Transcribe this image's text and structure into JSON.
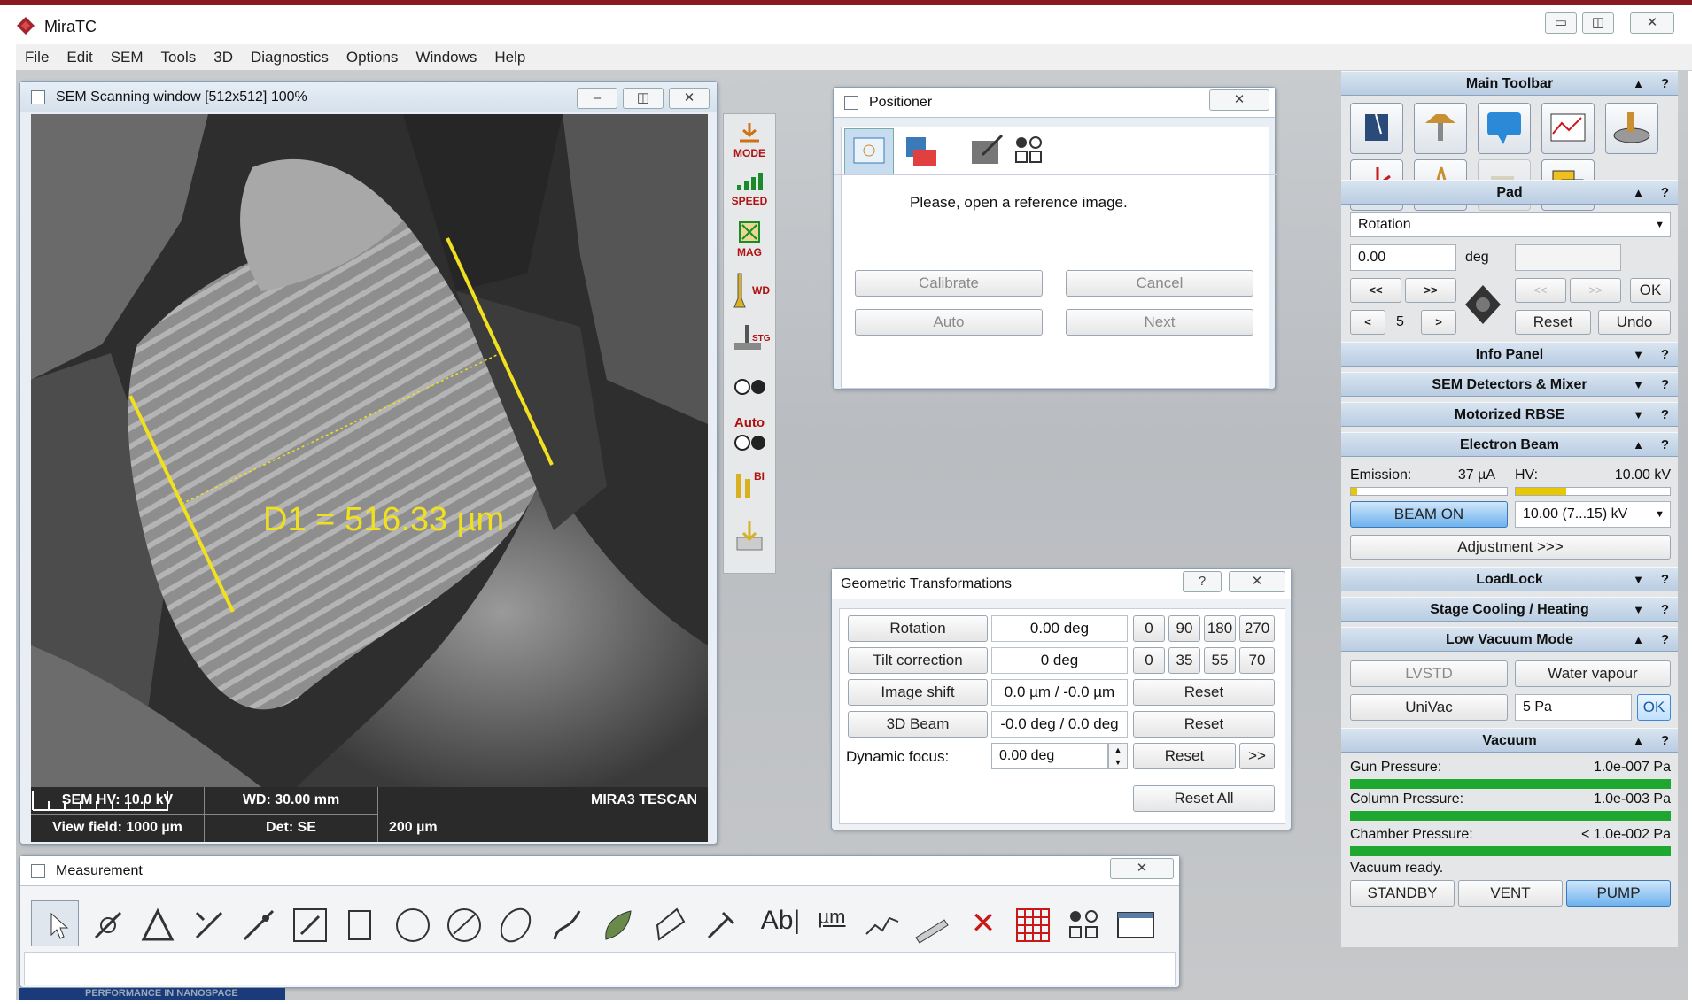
{
  "app": {
    "title": "MiraTC"
  },
  "menu": [
    "File",
    "Edit",
    "SEM",
    "Tools",
    "3D",
    "Diagnostics",
    "Options",
    "Windows",
    "Help"
  ],
  "sem_window": {
    "title": "SEM Scanning window [512x512] 100%",
    "measurement_label": "D1 = 516.33 µm",
    "info": {
      "hv": "SEM HV: 10.0 kV",
      "wd": "WD: 30.00 mm",
      "brand": "MIRA3 TESCAN",
      "view_field": "View field: 1000 µm",
      "det": "Det: SE",
      "scale": "200 µm"
    }
  },
  "side_tools": [
    "MODE",
    "SPEED",
    "MAG",
    "WD",
    "STG",
    "",
    "Auto",
    "BI",
    ""
  ],
  "positioner": {
    "title": "Positioner",
    "message": "Please, open a reference image.",
    "buttons": {
      "calibrate": "Calibrate",
      "cancel": "Cancel",
      "auto": "Auto",
      "next": "Next"
    }
  },
  "geo": {
    "title": "Geometric Transformations",
    "rows": [
      {
        "label": "Rotation",
        "value": "0.00 deg"
      },
      {
        "label": "Tilt correction",
        "value": "0 deg"
      },
      {
        "label": "Image shift",
        "value": "0.0 µm / -0.0 µm"
      },
      {
        "label": "3D Beam",
        "value": "-0.0 deg / 0.0 deg"
      }
    ],
    "rotation_presets": [
      "0",
      "90",
      "180",
      "270"
    ],
    "tilt_presets": [
      "0",
      "35",
      "55",
      "70"
    ],
    "reset": "Reset",
    "dynamic_focus_label": "Dynamic focus:",
    "dynamic_focus_value": "0.00 deg",
    "more": ">>",
    "reset_all": "Reset All"
  },
  "measurement": {
    "title": "Measurement",
    "text_tool": "Ab|",
    "unit_tool": "µm",
    "footer": "PERFORMANCE IN NANOSPACE"
  },
  "rpanel": {
    "main_toolbar": "Main Toolbar",
    "pad": "Pad",
    "pad_select": "Rotation",
    "pad_value": "0.00",
    "pad_unit": "deg",
    "pad_step": "5",
    "pad_btns": {
      "rewind": "<<",
      "ff": ">>",
      "rew2": "<<",
      "ff2": ">>",
      "ok": "OK",
      "prev": "<",
      "next": ">",
      "reset": "Reset",
      "undo": "Undo"
    },
    "info_panel": "Info Panel",
    "detectors": "SEM Detectors & Mixer",
    "rbse": "Motorized RBSE",
    "beam": "Electron Beam",
    "emission_label": "Emission:",
    "emission_value": "37 µA",
    "hv_label": "HV:",
    "hv_value": "10.00 kV",
    "beam_on": "BEAM ON",
    "hv_range": "10.00 (7...15) kV",
    "adjustment": "Adjustment >>>",
    "loadlock": "LoadLock",
    "cooling": "Stage Cooling / Heating",
    "lowvac": "Low Vacuum Mode",
    "lvstd": "LVSTD",
    "water": "Water vapour",
    "univac": "UniVac",
    "pa_value": "5 Pa",
    "ok": "OK",
    "vacuum": "Vacuum",
    "gun_label": "Gun Pressure:",
    "gun_value": "1.0e-007 Pa",
    "column_label": "Column Pressure:",
    "column_value": "1.0e-003 Pa",
    "chamber_label": "Chamber Pressure:",
    "chamber_value": "< 1.0e-002 Pa",
    "vac_status": "Vacuum ready.",
    "standby": "STANDBY",
    "vent": "VENT",
    "pump": "PUMP"
  },
  "colors": {
    "accent": "#3a8fd8",
    "stripe": "#8a1a22",
    "green": "#1ea830",
    "measure": "#f0e020"
  }
}
